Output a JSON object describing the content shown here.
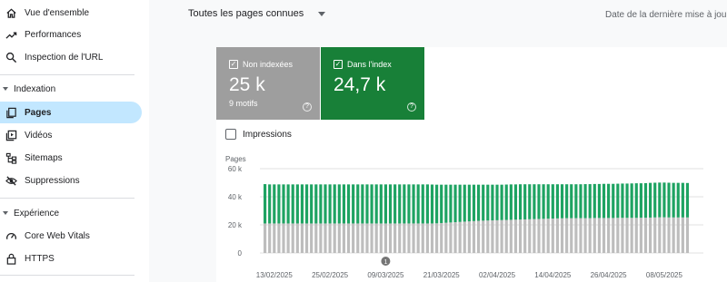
{
  "sidebar": {
    "items": [
      {
        "label": "Vue d'ensemble",
        "icon": "home-icon"
      },
      {
        "label": "Performances",
        "icon": "trending-up-icon"
      },
      {
        "label": "Inspection de l'URL",
        "icon": "search-icon"
      }
    ],
    "sections": [
      {
        "label": "Indexation",
        "items": [
          {
            "label": "Pages",
            "icon": "pages-icon",
            "active": true
          },
          {
            "label": "Vidéos",
            "icon": "video-icon"
          },
          {
            "label": "Sitemaps",
            "icon": "sitemap-icon"
          },
          {
            "label": "Suppressions",
            "icon": "eye-off-icon"
          }
        ]
      },
      {
        "label": "Expérience",
        "items": [
          {
            "label": "Core Web Vitals",
            "icon": "speed-gauge-icon"
          },
          {
            "label": "HTTPS",
            "icon": "lock-icon"
          }
        ]
      }
    ]
  },
  "header": {
    "filter_label": "Toutes les pages connues",
    "last_update_label": "Date de la dernière mise à jour :"
  },
  "tiles": {
    "not_indexed": {
      "label": "Non indexées",
      "value": "25 k",
      "sub": "9 motifs",
      "color": "#9e9e9e"
    },
    "indexed": {
      "label": "Dans l'index",
      "value": "24,7 k",
      "color": "#188038"
    }
  },
  "impressions_label": "Impressions",
  "annotation_marker": "1",
  "colors": {
    "accent_active": "#c2e7ff",
    "not_indexed": "#bdbdbd",
    "indexed": "#1ea362"
  },
  "chart_data": {
    "type": "bar",
    "stacked": true,
    "ylabel": "Pages",
    "ylim": [
      0,
      60000
    ],
    "yticks": [
      "0",
      "20 k",
      "40 k",
      "60 k"
    ],
    "grid": true,
    "x_tick_labels": [
      "13/02/2025",
      "25/02/2025",
      "09/03/2025",
      "21/03/2025",
      "02/04/2025",
      "14/04/2025",
      "26/04/2025",
      "08/05/2025"
    ],
    "x_tick_indices": [
      2,
      14,
      26,
      38,
      50,
      62,
      74,
      86
    ],
    "annotation_index": 26,
    "series": [
      {
        "name": "Non indexées",
        "values": [
          21000,
          21000,
          21000,
          21000,
          21000,
          21000,
          21000,
          21000,
          21000,
          21000,
          21000,
          21000,
          21000,
          21000,
          21000,
          21000,
          21000,
          21000,
          21000,
          21000,
          21000,
          21000,
          21000,
          21000,
          21000,
          21000,
          21000,
          21000,
          21000,
          21000,
          21000,
          21000,
          21000,
          21000,
          21000,
          21000,
          21000,
          21100,
          21300,
          21500,
          21700,
          21900,
          22100,
          22300,
          22500,
          22700,
          22900,
          23000,
          23100,
          23200,
          23300,
          23400,
          23500,
          23600,
          23700,
          23800,
          23900,
          24000,
          24100,
          24200,
          24300,
          24400,
          24500,
          24600,
          24700,
          24800,
          24800,
          24800,
          24800,
          24800,
          24800,
          24900,
          24900,
          24900,
          24900,
          24900,
          25000,
          25000,
          25000,
          25000,
          25000,
          25100,
          25100,
          25200,
          25300,
          25400,
          25400,
          25300,
          25300,
          25300,
          25300,
          25300
        ]
      },
      {
        "name": "Dans l'index",
        "values": [
          28000,
          27800,
          27800,
          27800,
          27800,
          27800,
          27800,
          27800,
          27800,
          27800,
          27800,
          27800,
          27800,
          27800,
          27800,
          27800,
          27800,
          27800,
          27800,
          27800,
          27800,
          27800,
          27800,
          27800,
          27800,
          27800,
          27800,
          27800,
          27800,
          27800,
          27800,
          27800,
          27800,
          27800,
          27800,
          27800,
          27700,
          27500,
          27300,
          27100,
          26900,
          26700,
          26500,
          26300,
          26100,
          25900,
          25700,
          25600,
          25500,
          25400,
          25300,
          25200,
          25200,
          25200,
          25100,
          25100,
          25000,
          24900,
          24800,
          24700,
          24600,
          24500,
          24400,
          24300,
          24200,
          24100,
          24100,
          24100,
          24100,
          24200,
          24200,
          24200,
          24200,
          24300,
          24300,
          24300,
          24300,
          24400,
          24400,
          24500,
          24600,
          24500,
          24600,
          24700,
          24700,
          24700,
          24700,
          24700,
          24600,
          24600,
          24600,
          24500
        ]
      }
    ]
  }
}
